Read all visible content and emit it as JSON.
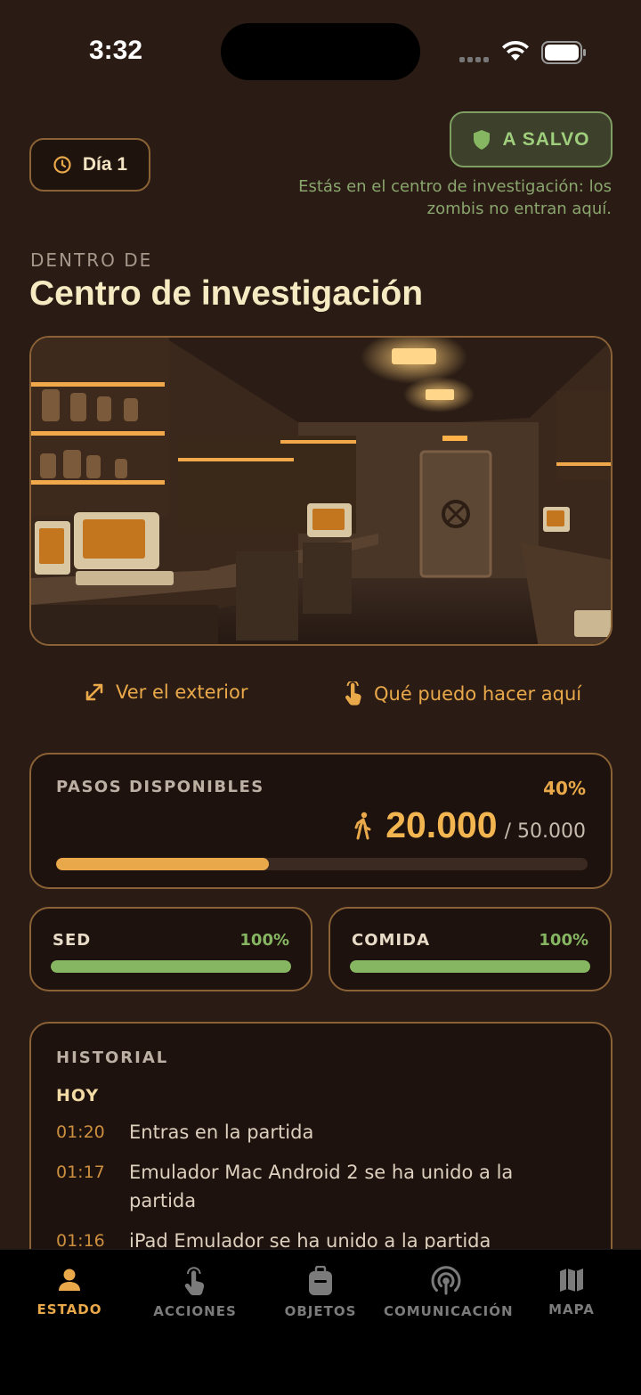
{
  "status_bar": {
    "time": "3:32"
  },
  "header": {
    "day_label": "Día 1",
    "safe_label": "A SALVO",
    "safe_description": "Estás en el centro de investigación: los zombis no entran aquí.",
    "location_kicker": "DENTRO DE",
    "location_title": "Centro de investigación"
  },
  "links": {
    "exterior": "Ver el exterior",
    "what_can_i_do": "Qué puedo hacer aquí"
  },
  "steps": {
    "label": "PASOS DISPONIBLES",
    "percent_label": "40%",
    "value": "20.000",
    "total": "/ 50.000",
    "fraction": 0.4
  },
  "stats": [
    {
      "label": "SED",
      "percent_label": "100%",
      "fraction": 1.0
    },
    {
      "label": "COMIDA",
      "percent_label": "100%",
      "fraction": 1.0
    }
  ],
  "history": {
    "label": "HISTORIAL",
    "group": "HOY",
    "entries": [
      {
        "time": "01:20",
        "text": "Entras en la partida"
      },
      {
        "time": "01:17",
        "text": "Emulador Mac Android 2 se ha unido a la partida"
      },
      {
        "time": "01:16",
        "text": "iPad Emulador se ha unido a la partida"
      }
    ]
  },
  "tabs": [
    {
      "label": "ESTADO",
      "icon": "person-icon",
      "active": true
    },
    {
      "label": "ACCIONES",
      "icon": "tap-hand-icon",
      "active": false
    },
    {
      "label": "OBJETOS",
      "icon": "backpack-icon",
      "active": false
    },
    {
      "label": "COMUNICACIÓN",
      "icon": "broadcast-icon",
      "active": false
    },
    {
      "label": "MAPA",
      "icon": "map-icon",
      "active": false
    }
  ],
  "colors": {
    "background": "#2a1b14",
    "accent": "#e9a94a",
    "safe_green": "#86b661",
    "card_border": "#8a6236"
  }
}
